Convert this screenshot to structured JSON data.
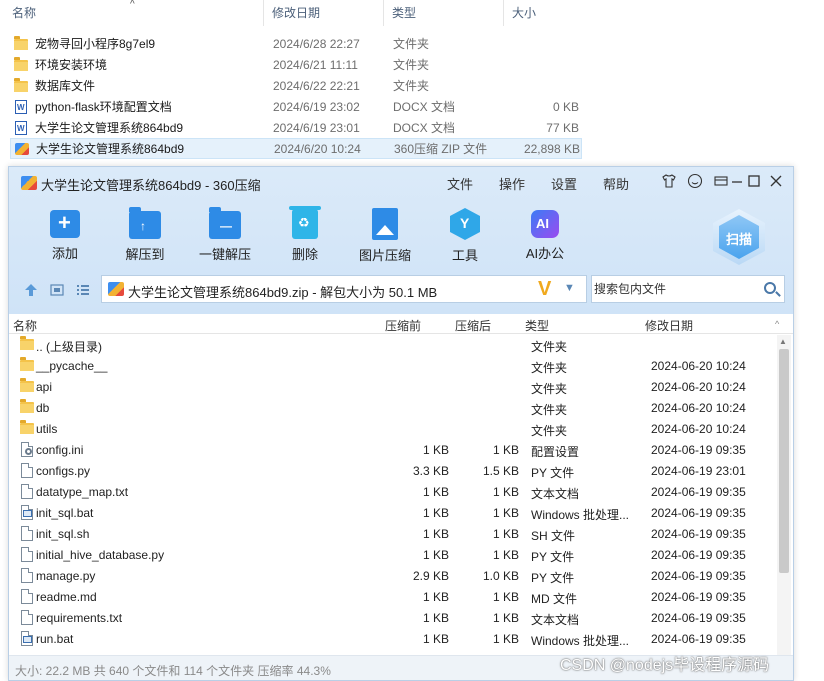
{
  "explorer": {
    "columns": {
      "name": "名称",
      "date": "修改日期",
      "type": "类型",
      "size": "大小"
    },
    "items": [
      {
        "name": "宠物寻回小程序8g7el9",
        "date": "2024/6/28 22:27",
        "type": "文件夹",
        "size": "",
        "icon": "folder-icon"
      },
      {
        "name": "环境安装环境",
        "date": "2024/6/21 11:11",
        "type": "文件夹",
        "size": "",
        "icon": "folder-icon"
      },
      {
        "name": "数据库文件",
        "date": "2024/6/22 22:21",
        "type": "文件夹",
        "size": "",
        "icon": "folder-icon"
      },
      {
        "name": "python-flask环境配置文档",
        "date": "2024/6/19 23:02",
        "type": "DOCX 文档",
        "size": "0 KB",
        "icon": "word-doc-icon"
      },
      {
        "name": "大学生论文管理系统864bd9",
        "date": "2024/6/19 23:01",
        "type": "DOCX 文档",
        "size": "77 KB",
        "icon": "word-doc-icon"
      },
      {
        "name": "大学生论文管理系统864bd9",
        "date": "2024/6/20 10:24",
        "type": "360压缩 ZIP 文件",
        "size": "22,898 KB",
        "icon": "zip-archive-icon"
      }
    ]
  },
  "zip_window": {
    "title": "大学生论文管理系统864bd9 - 360压缩",
    "menu": [
      "文件",
      "操作",
      "设置",
      "帮助"
    ],
    "window_controls": [
      "shirt-icon",
      "smiley-icon",
      "menu-icon",
      "minimize-icon",
      "maximize-icon",
      "close-icon"
    ],
    "toolbar": [
      {
        "label": "添加",
        "icon": "add-icon"
      },
      {
        "label": "解压到",
        "icon": "extract-to-icon"
      },
      {
        "label": "一键解压",
        "icon": "one-click-extract-icon"
      },
      {
        "label": "删除",
        "icon": "delete-icon"
      },
      {
        "label": "图片压缩",
        "icon": "image-compress-icon"
      },
      {
        "label": "工具",
        "icon": "tools-icon"
      },
      {
        "label": "AI办公",
        "icon": "ai-office-icon"
      }
    ],
    "scan_label": "扫描",
    "address": "大学生论文管理系统864bd9.zip - 解包大小为 50.1 MB",
    "search_placeholder": "搜索包内文件",
    "columns": {
      "name": "名称",
      "compressed_before": "压缩前",
      "compressed_after": "压缩后",
      "type": "类型",
      "modified": "修改日期"
    },
    "files": [
      {
        "name": ".. (上级目录)",
        "before": "",
        "after": "",
        "type": "文件夹",
        "date": "",
        "icon": "folder-icon"
      },
      {
        "name": "__pycache__",
        "before": "",
        "after": "",
        "type": "文件夹",
        "date": "2024-06-20 10:24",
        "icon": "folder-icon"
      },
      {
        "name": "api",
        "before": "",
        "after": "",
        "type": "文件夹",
        "date": "2024-06-20 10:24",
        "icon": "folder-icon"
      },
      {
        "name": "db",
        "before": "",
        "after": "",
        "type": "文件夹",
        "date": "2024-06-20 10:24",
        "icon": "folder-icon"
      },
      {
        "name": "utils",
        "before": "",
        "after": "",
        "type": "文件夹",
        "date": "2024-06-20 10:24",
        "icon": "folder-icon"
      },
      {
        "name": "config.ini",
        "before": "1 KB",
        "after": "1 KB",
        "type": "配置设置",
        "date": "2024-06-19 09:35",
        "icon": "config-file-icon"
      },
      {
        "name": "configs.py",
        "before": "3.3 KB",
        "after": "1.5 KB",
        "type": "PY 文件",
        "date": "2024-06-19 23:01",
        "icon": "file-icon"
      },
      {
        "name": "datatype_map.txt",
        "before": "1 KB",
        "after": "1 KB",
        "type": "文本文档",
        "date": "2024-06-19 09:35",
        "icon": "file-icon"
      },
      {
        "name": "init_sql.bat",
        "before": "1 KB",
        "after": "1 KB",
        "type": "Windows 批处理...",
        "date": "2024-06-19 09:35",
        "icon": "batch-file-icon"
      },
      {
        "name": "init_sql.sh",
        "before": "1 KB",
        "after": "1 KB",
        "type": "SH 文件",
        "date": "2024-06-19 09:35",
        "icon": "file-icon"
      },
      {
        "name": "initial_hive_database.py",
        "before": "1 KB",
        "after": "1 KB",
        "type": "PY 文件",
        "date": "2024-06-19 09:35",
        "icon": "file-icon"
      },
      {
        "name": "manage.py",
        "before": "2.9 KB",
        "after": "1.0 KB",
        "type": "PY 文件",
        "date": "2024-06-19 09:35",
        "icon": "file-icon"
      },
      {
        "name": "readme.md",
        "before": "1 KB",
        "after": "1 KB",
        "type": "MD 文件",
        "date": "2024-06-19 09:35",
        "icon": "file-icon"
      },
      {
        "name": "requirements.txt",
        "before": "1 KB",
        "after": "1 KB",
        "type": "文本文档",
        "date": "2024-06-19 09:35",
        "icon": "file-icon"
      },
      {
        "name": "run.bat",
        "before": "1 KB",
        "after": "1 KB",
        "type": "Windows 批处理...",
        "date": "2024-06-19 09:35",
        "icon": "batch-file-icon"
      }
    ],
    "status": "大小: 22.2 MB 共 640 个文件和 114 个文件夹 压缩率 44.3%"
  },
  "watermark": "CSDN @nodejs毕设程序源码",
  "colors": {
    "accent": "#2e8be6",
    "window_bg": "#d6e7f8",
    "selection": "#e5f1fb"
  }
}
